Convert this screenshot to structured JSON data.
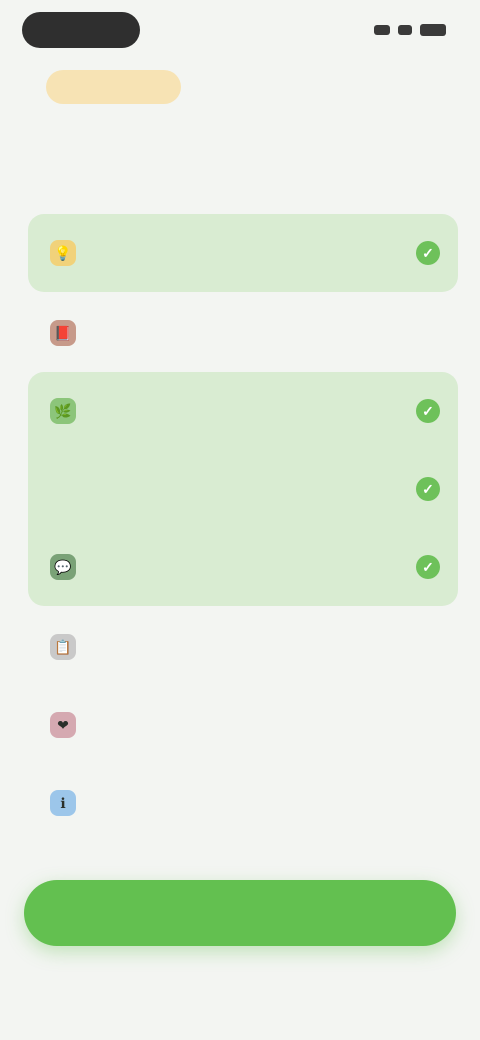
{
  "badge": {
    "label": ""
  },
  "question": {
    "text": ""
  },
  "options": [
    {
      "label": "",
      "icon": "lightbulb-icon",
      "icon_color": "#f1d27a",
      "selected": true
    },
    {
      "label": "",
      "icon": "book-icon",
      "icon_color": "#c79a8a",
      "selected": false
    },
    {
      "label": "",
      "icon": "leaf-icon",
      "icon_color": "#8cc57a",
      "selected": true
    },
    {
      "label": "",
      "icon": "",
      "icon_color": "",
      "selected": true
    },
    {
      "label": "",
      "icon": "chat-icon",
      "icon_color": "#7aa277",
      "selected": true
    },
    {
      "label": "",
      "icon": "clipboard-icon",
      "icon_color": "#c9c9c9",
      "selected": false
    },
    {
      "label": "",
      "icon": "heart-icon",
      "icon_color": "#d5a9b1",
      "selected": false
    },
    {
      "label": "",
      "icon": "info-icon",
      "icon_color": "#9cc6ea",
      "selected": false
    }
  ],
  "cta": {
    "label": ""
  },
  "colors": {
    "accent": "#63c050",
    "selected_bg": "#d9ecd2",
    "badge_bg": "#f7e3b4"
  }
}
